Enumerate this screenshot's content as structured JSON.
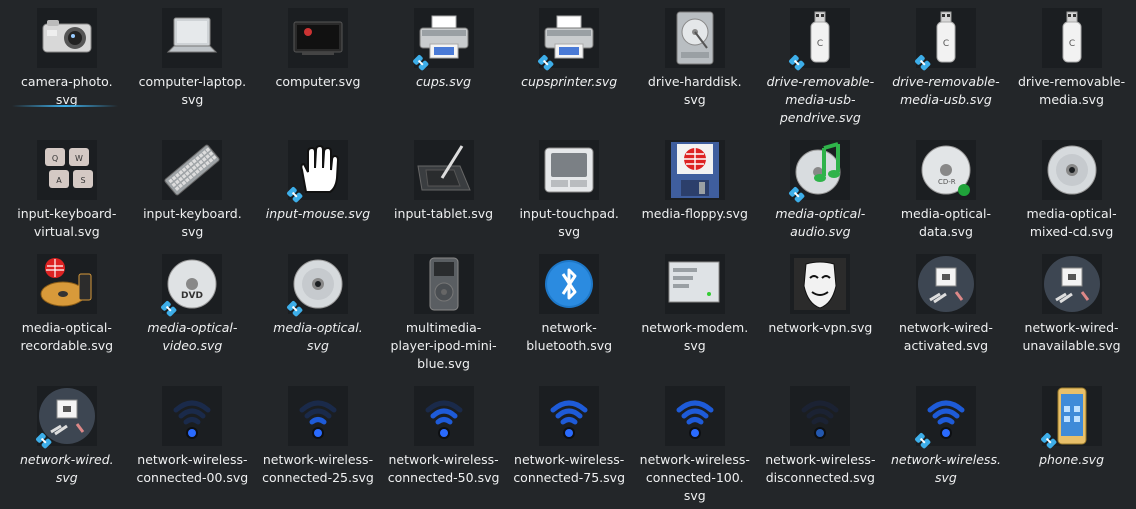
{
  "items": [
    {
      "label": "camera-photo.\nsvg",
      "icon": "camera-photo-icon",
      "link": false,
      "selected": true
    },
    {
      "label": "computer-laptop.\nsvg",
      "icon": "laptop-icon",
      "link": false
    },
    {
      "label": "computer.svg",
      "icon": "computer-icon",
      "link": false
    },
    {
      "label": "cups.svg",
      "icon": "printer-icon",
      "link": true
    },
    {
      "label": "cupsprinter.svg",
      "icon": "printer-icon",
      "link": true
    },
    {
      "label": "drive-harddisk.\nsvg",
      "icon": "harddisk-icon",
      "link": false
    },
    {
      "label": "drive-removable-\nmedia-usb-\npendrive.svg",
      "icon": "usb-drive-icon",
      "link": true
    },
    {
      "label": "drive-removable-\nmedia-usb.svg",
      "icon": "usb-drive-icon",
      "link": true
    },
    {
      "label": "drive-removable-\nmedia.svg",
      "icon": "usb-drive-icon",
      "link": false
    },
    {
      "label": "input-keyboard-\nvirtual.svg",
      "icon": "virtual-keyboard-icon",
      "link": false
    },
    {
      "label": "input-keyboard.\nsvg",
      "icon": "keyboard-icon",
      "link": false
    },
    {
      "label": "input-mouse.svg",
      "icon": "mouse-hand-icon",
      "link": true
    },
    {
      "label": "input-tablet.svg",
      "icon": "tablet-icon",
      "link": false
    },
    {
      "label": "input-touchpad.\nsvg",
      "icon": "touchpad-icon",
      "link": false
    },
    {
      "label": "media-floppy.svg",
      "icon": "floppy-icon",
      "link": false
    },
    {
      "label": "media-optical-\naudio.svg",
      "icon": "optical-audio-icon",
      "link": true
    },
    {
      "label": "media-optical-\ndata.svg",
      "icon": "optical-data-icon",
      "link": false
    },
    {
      "label": "media-optical-\nmixed-cd.svg",
      "icon": "optical-disc-icon",
      "link": false
    },
    {
      "label": "media-optical-\nrecordable.svg",
      "icon": "optical-recordable-icon",
      "link": false
    },
    {
      "label": "media-optical-\nvideo.svg",
      "icon": "optical-video-icon",
      "link": true
    },
    {
      "label": "media-optical.\nsvg",
      "icon": "optical-disc-icon",
      "link": true
    },
    {
      "label": "multimedia-\nplayer-ipod-mini-\nblue.svg",
      "icon": "ipod-icon",
      "link": false
    },
    {
      "label": "network-\nbluetooth.svg",
      "icon": "bluetooth-icon",
      "link": false
    },
    {
      "label": "network-modem.\nsvg",
      "icon": "modem-icon",
      "link": false
    },
    {
      "label": "network-vpn.svg",
      "icon": "vpn-mask-icon",
      "link": false
    },
    {
      "label": "network-wired-\nactivated.svg",
      "icon": "network-wired-icon",
      "link": false
    },
    {
      "label": "network-wired-\nunavailable.svg",
      "icon": "network-wired-icon",
      "link": false
    },
    {
      "label": "network-wired.\nsvg",
      "icon": "network-wired-icon",
      "link": true
    },
    {
      "label": "network-wireless-\nconnected-00.svg",
      "icon": "wireless-icon",
      "link": false,
      "strength": 0
    },
    {
      "label": "network-wireless-\nconnected-25.svg",
      "icon": "wireless-icon",
      "link": false,
      "strength": 25
    },
    {
      "label": "network-wireless-\nconnected-50.svg",
      "icon": "wireless-icon",
      "link": false,
      "strength": 50
    },
    {
      "label": "network-wireless-\nconnected-75.svg",
      "icon": "wireless-icon",
      "link": false,
      "strength": 75
    },
    {
      "label": "network-wireless-\nconnected-100.\nsvg",
      "icon": "wireless-icon",
      "link": false,
      "strength": 100
    },
    {
      "label": "network-wireless-\ndisconnected.svg",
      "icon": "wireless-icon",
      "link": false,
      "strength": -1
    },
    {
      "label": "network-wireless.\nsvg",
      "icon": "wireless-icon",
      "link": true,
      "strength": 75
    },
    {
      "label": "phone.svg",
      "icon": "phone-icon",
      "link": true
    }
  ]
}
